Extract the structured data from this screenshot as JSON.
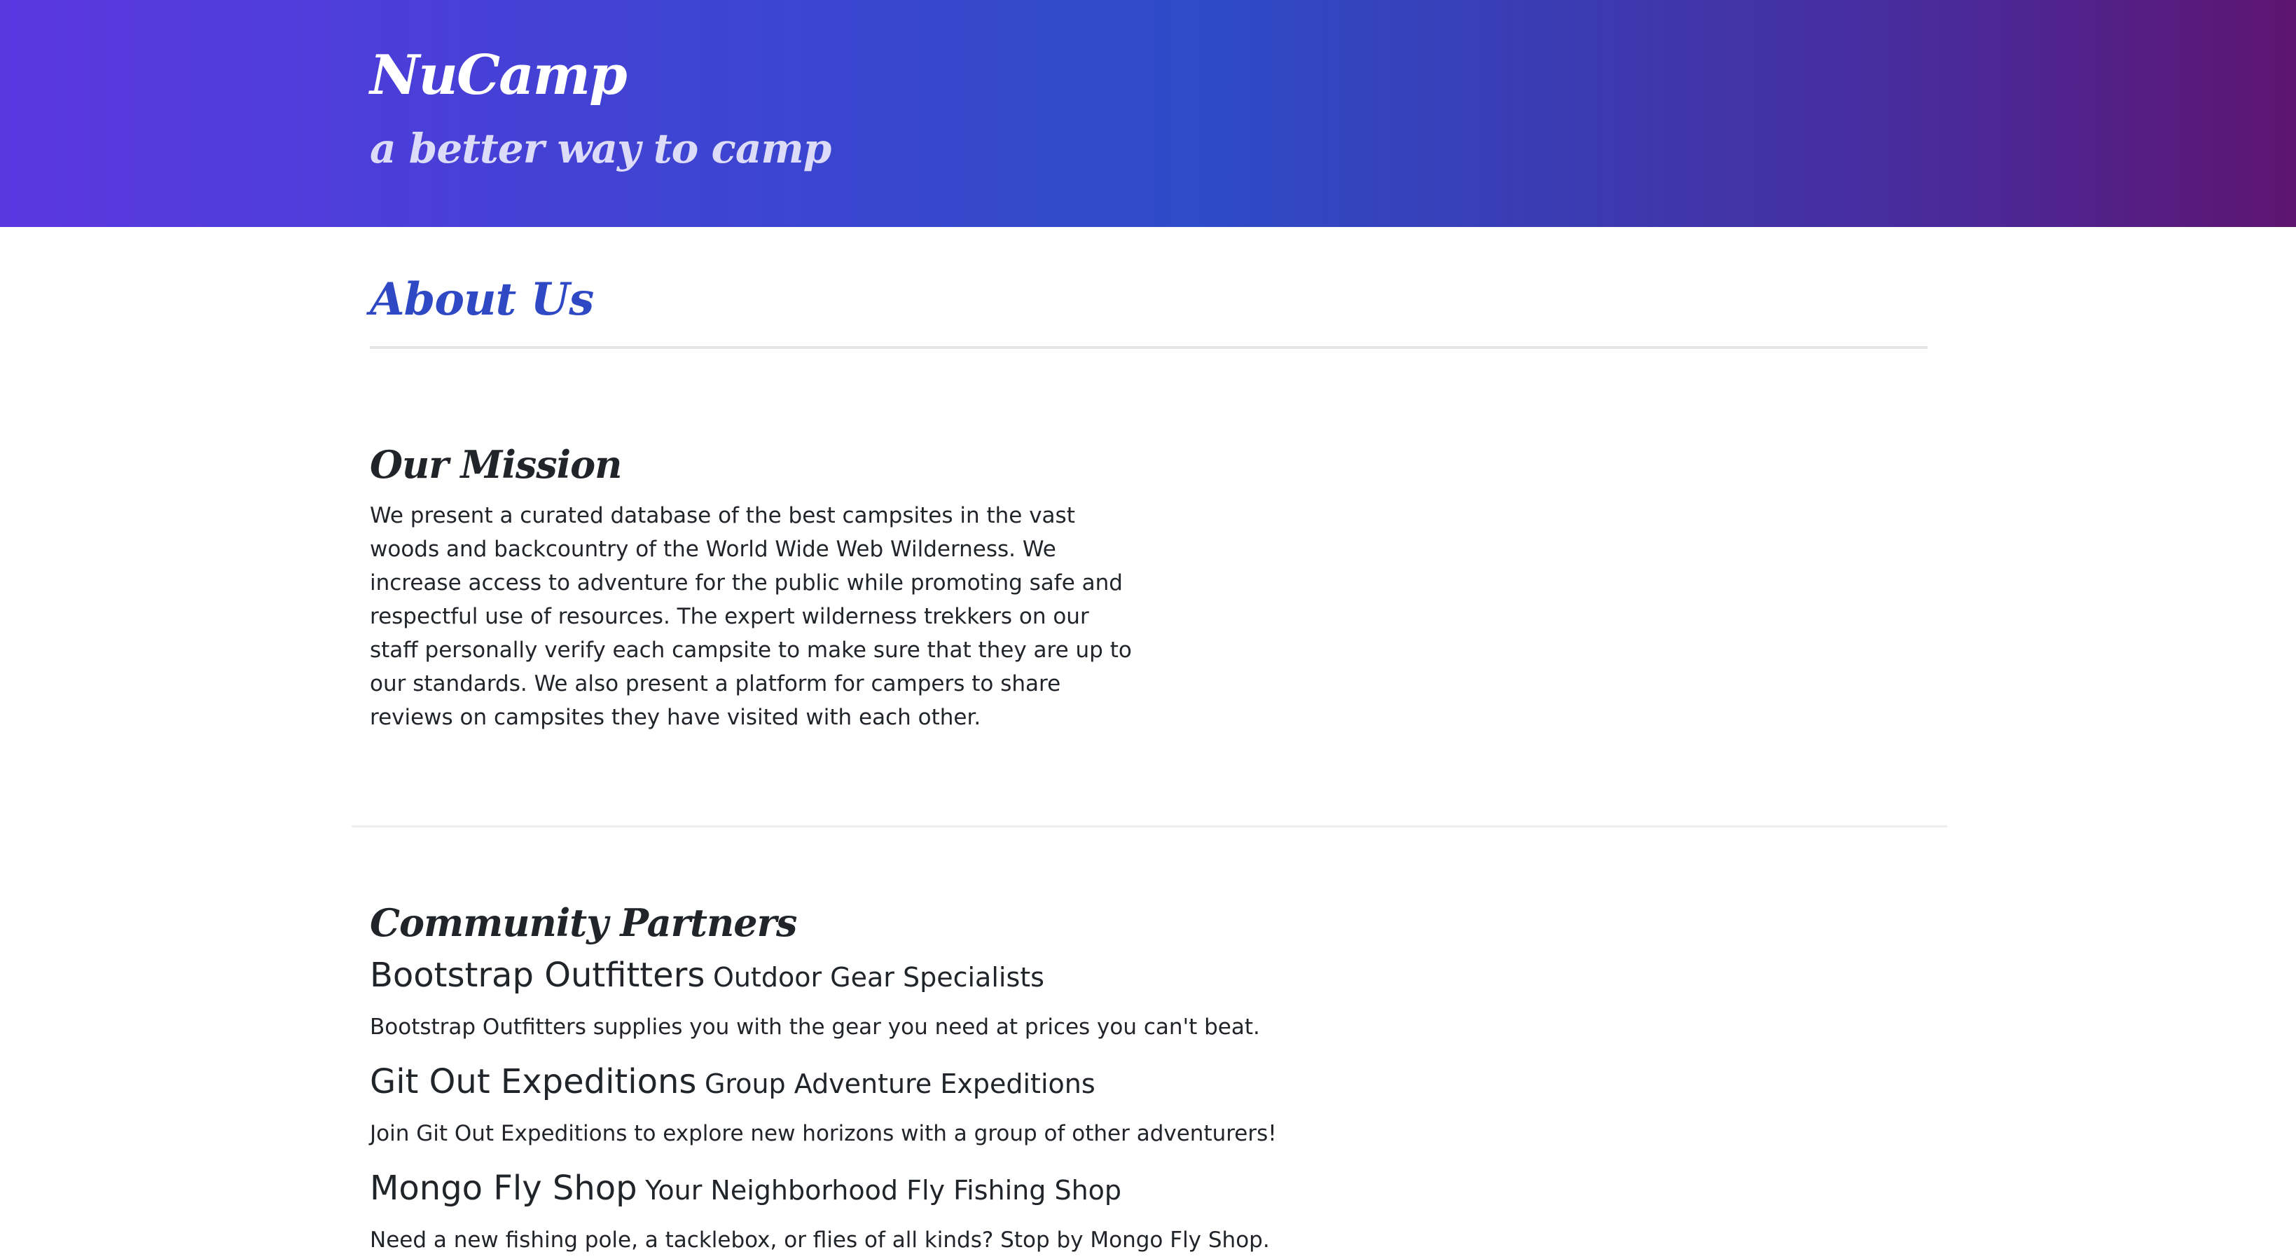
{
  "header": {
    "brand": "NuCamp",
    "tagline": "a better way to camp"
  },
  "page": {
    "title": "About Us"
  },
  "mission": {
    "heading": "Our Mission",
    "text": "We present a curated database of the best campsites in the vast woods and backcountry of the World Wide Web Wilderness. We increase access to adventure for the public while promoting safe and respectful use of resources. The expert wilderness trekkers on our staff personally verify each campsite to make sure that they are up to our standards. We also present a platform for campers to share reviews on campsites they have visited with each other."
  },
  "partners": {
    "heading": "Community Partners",
    "items": [
      {
        "name": "Bootstrap Outfitters",
        "subtitle": "Outdoor Gear Specialists",
        "description": "Bootstrap Outfitters supplies you with the gear you need at prices you can't beat."
      },
      {
        "name": "Git Out Expeditions",
        "subtitle": "Group Adventure Expeditions",
        "description": "Join Git Out Expeditions to explore new horizons with a group of other adventurers!"
      },
      {
        "name": "Mongo Fly Shop",
        "subtitle": "Your Neighborhood Fly Fishing Shop",
        "description": "Need a new fishing pole, a tacklebox, or flies of all kinds? Stop by Mongo Fly Shop."
      }
    ]
  },
  "colors": {
    "accent": "#2f49c4",
    "header_gradient_start": "#5b37e0",
    "header_gradient_mid": "#2e4bc8",
    "header_gradient_end": "#5e1470"
  }
}
